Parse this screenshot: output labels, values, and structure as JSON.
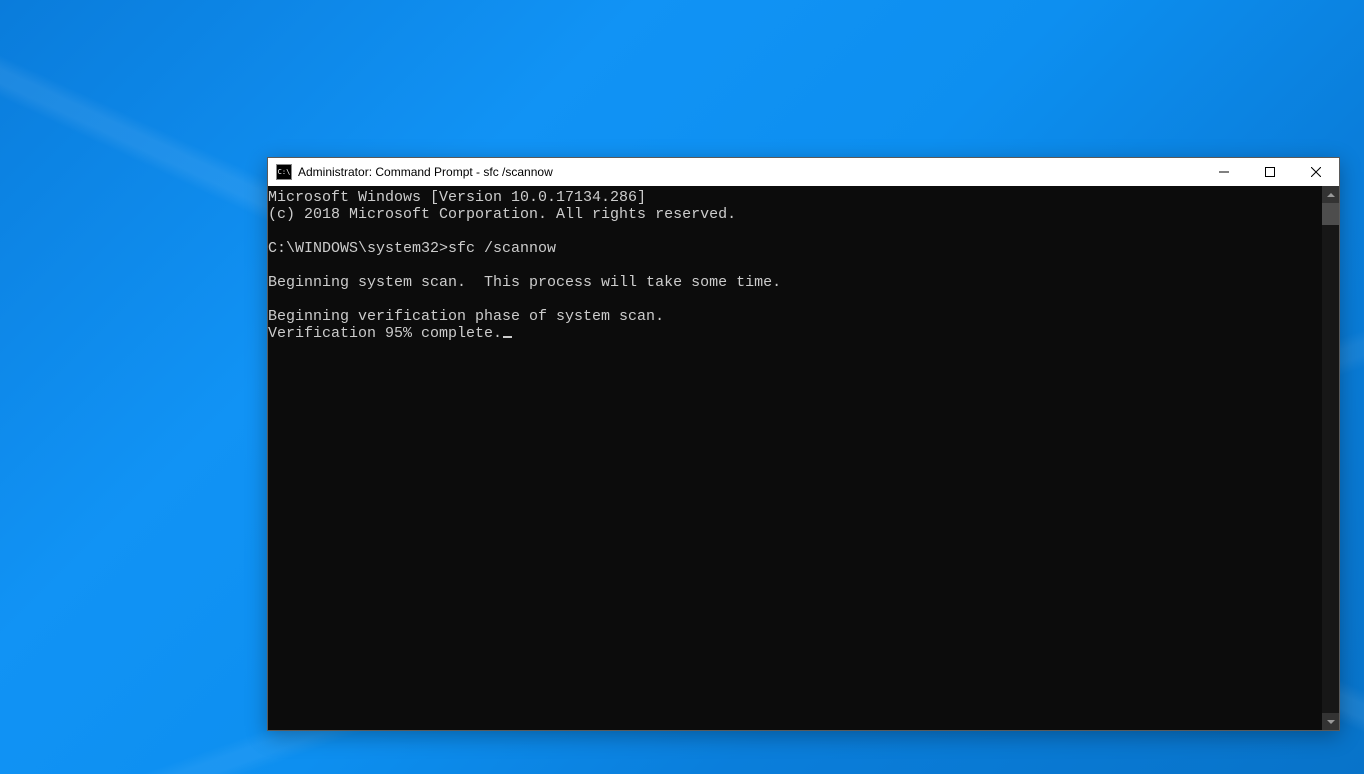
{
  "window": {
    "title": "Administrator: Command Prompt - sfc  /scannow"
  },
  "console": {
    "line1": "Microsoft Windows [Version 10.0.17134.286]",
    "line2": "(c) 2018 Microsoft Corporation. All rights reserved.",
    "prompt_line": "C:\\WINDOWS\\system32>sfc /scannow",
    "line3": "Beginning system scan.  This process will take some time.",
    "line4": "Beginning verification phase of system scan.",
    "line5": "Verification 95% complete."
  }
}
